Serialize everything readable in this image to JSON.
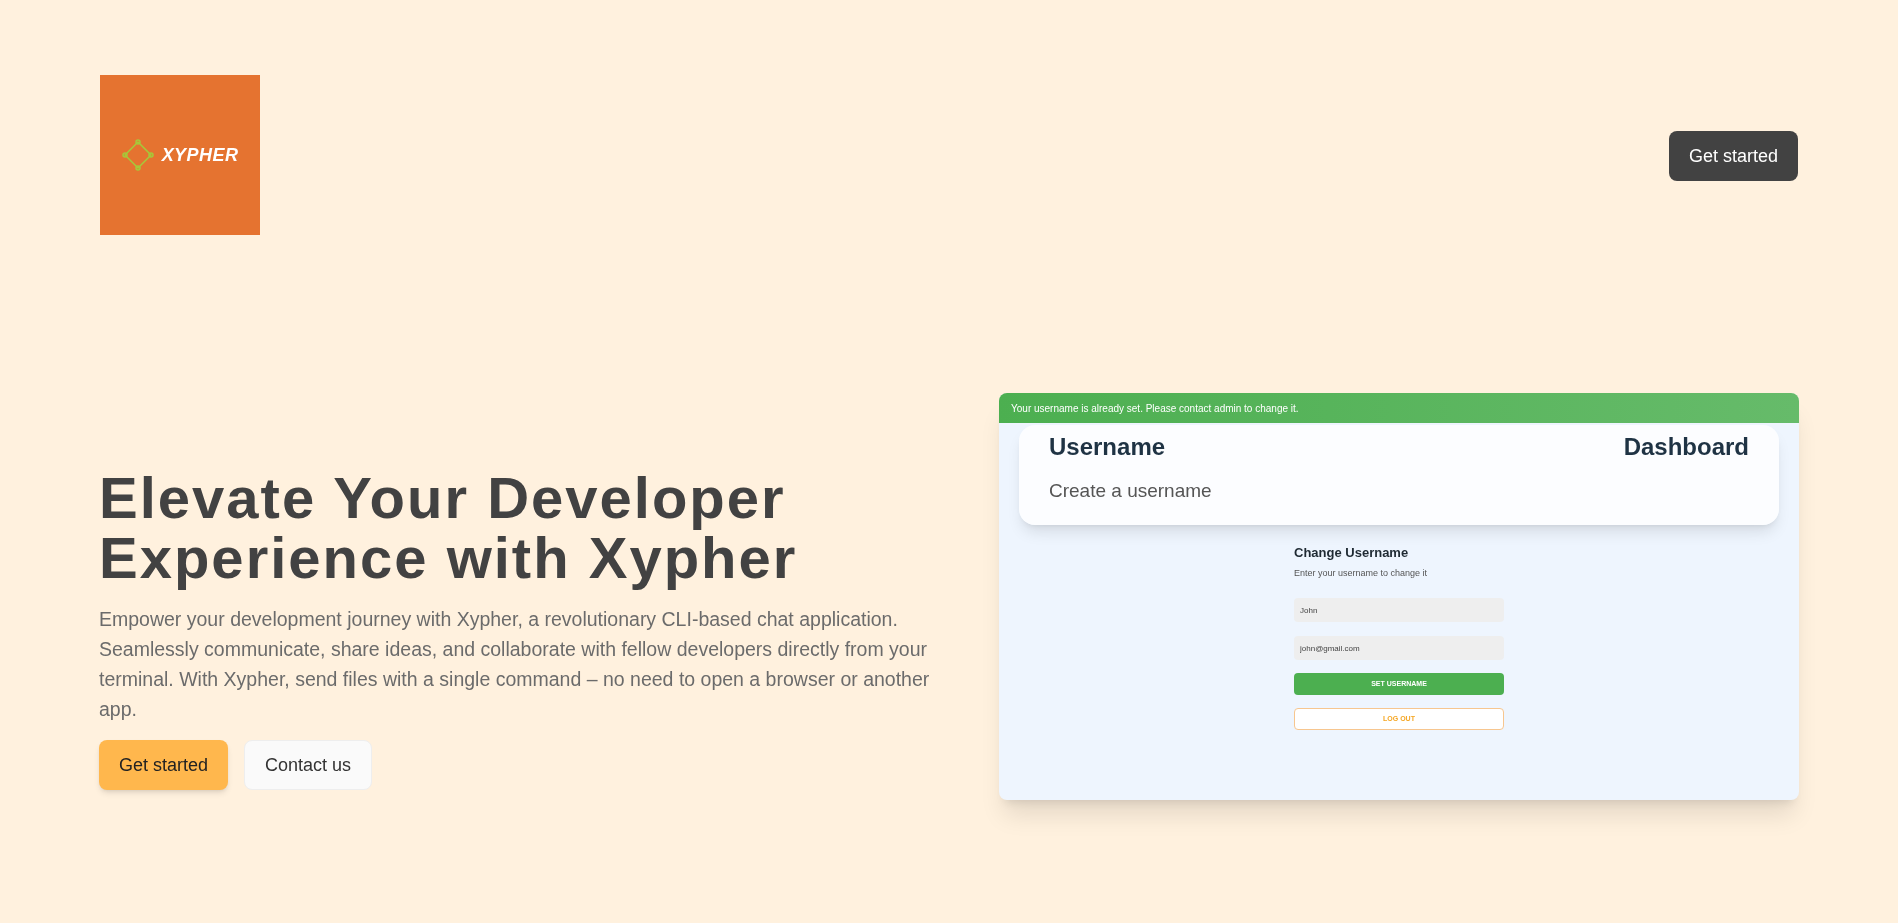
{
  "header": {
    "logo": {
      "wordmark": "XYPHER"
    },
    "cta": "Get started"
  },
  "hero": {
    "title_lines": [
      "Elevate Your Developer",
      "Experience with Xypher"
    ],
    "description": "Empower your development journey with Xypher, a revolutionary CLI-based chat application. Seamlessly communicate, share ideas, and collaborate with fellow developers directly from your terminal. With Xypher, send files with a single command – no need to open a browser or another app.",
    "buttons": [
      {
        "label": "Get started",
        "kind": "primary"
      },
      {
        "label": "Contact us",
        "kind": "secondary"
      }
    ]
  },
  "preview": {
    "banner": "Your username is already set. Please contact admin to change it.",
    "card": {
      "title": "Username",
      "subtitle": "Create a username",
      "right_title": "Dashboard"
    },
    "form": {
      "title": "Change Username",
      "hint": "Enter your username to change it",
      "fields": [
        {
          "value": "John"
        },
        {
          "value": "john@gmail.com"
        }
      ],
      "buttons": [
        {
          "label": "SET USERNAME",
          "kind": "solid"
        },
        {
          "label": "LOG OUT",
          "kind": "outline"
        }
      ]
    }
  }
}
